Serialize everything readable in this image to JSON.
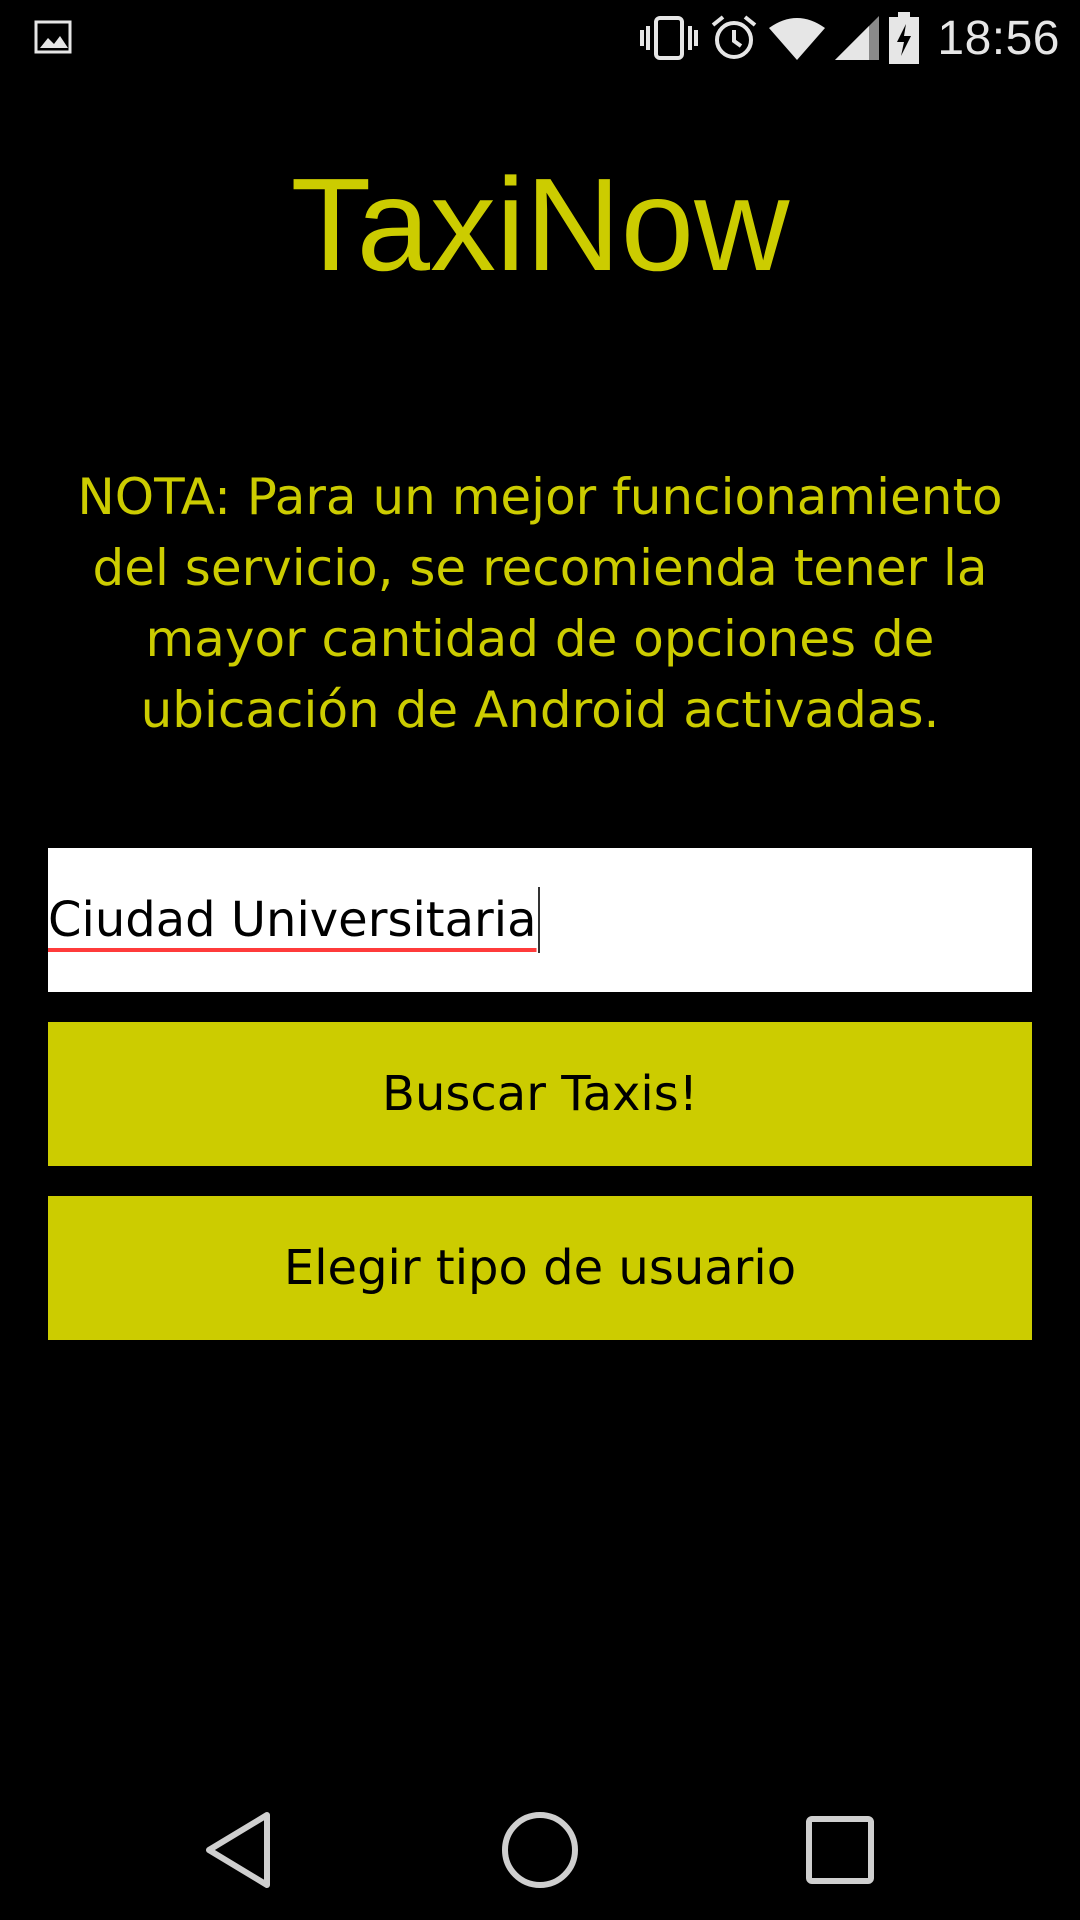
{
  "status_bar": {
    "time": "18:56",
    "icons": [
      "gallery-icon",
      "vibrate-icon",
      "alarm-icon",
      "wifi-icon",
      "signal-icon",
      "battery-charging-icon"
    ]
  },
  "app": {
    "title": "TaxiNow",
    "note": "NOTA: Para un mejor funcionamiento del servicio, se recomienda tener la mayor cantidad de opciones de ubicación de Android activadas.",
    "location_input": {
      "value": "Ciudad Universitaria"
    },
    "search_button": "Buscar Taxis!",
    "user_type_button": "Elegir tipo de usuario"
  },
  "colors": {
    "accent": "#cccc00",
    "background": "#000000",
    "spellcheck_underline": "#ff3b3b"
  },
  "nav_bar": {
    "icons": [
      "back-icon",
      "home-icon",
      "recents-icon"
    ]
  }
}
